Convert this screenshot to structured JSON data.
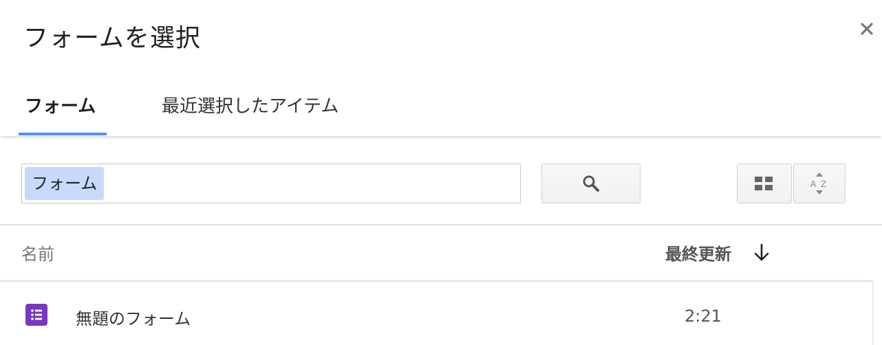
{
  "dialog": {
    "title": "フォームを選択",
    "close_glyph": "×"
  },
  "tabs": [
    {
      "label": "フォーム",
      "active": true
    },
    {
      "label": "最近選択したアイテム",
      "active": false
    }
  ],
  "search": {
    "chip_label": "フォーム",
    "button_icon": "search-icon"
  },
  "toolbar": {
    "view_icon": "grid-view-icon",
    "sort_icon": "sort-az-icon"
  },
  "list": {
    "column_name": "名前",
    "column_modified": "最終更新",
    "sort_direction_icon": "arrow-down-icon",
    "items": [
      {
        "icon": "forms-icon",
        "name": "無題のフォーム",
        "modified": "2:21",
        "icon_color": "#7b35c2"
      }
    ]
  },
  "colors": {
    "accent": "#4d90fe",
    "chip": "#c6dafc"
  }
}
